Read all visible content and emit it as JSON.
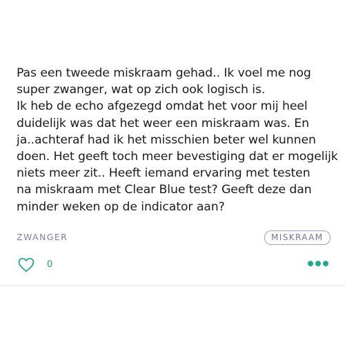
{
  "post": {
    "lines": [
      "Pas een tweede miskraam gehad.. Ik voel me nog",
      "super zwanger, wat op zich ook logisch is.",
      "Ik heb de echo afgezegd omdat het voor mij heel",
      "duidelijk was dat het weer een miskraam was. En",
      "ja..achteraf had ik het misschien beter wel kunnen",
      "doen. Het geeft toch meer bevestiging dat er mogelijk",
      "niets meer zit.. Heeft iemand ervaring met testen",
      "na miskraam met Clear Blue test? Geeft deze dan",
      "minder weken op de indicator aan?"
    ],
    "category": "ZWANGER",
    "tag": "MISKRAAM",
    "like_count": "0",
    "like_icon": "heart-outline-icon",
    "more_icon": "more-dots-icon"
  },
  "colors": {
    "text": "#1c1c1c",
    "category": "#8a7aa8",
    "tag_border": "#a79bbf",
    "accent": "#20a88e"
  }
}
